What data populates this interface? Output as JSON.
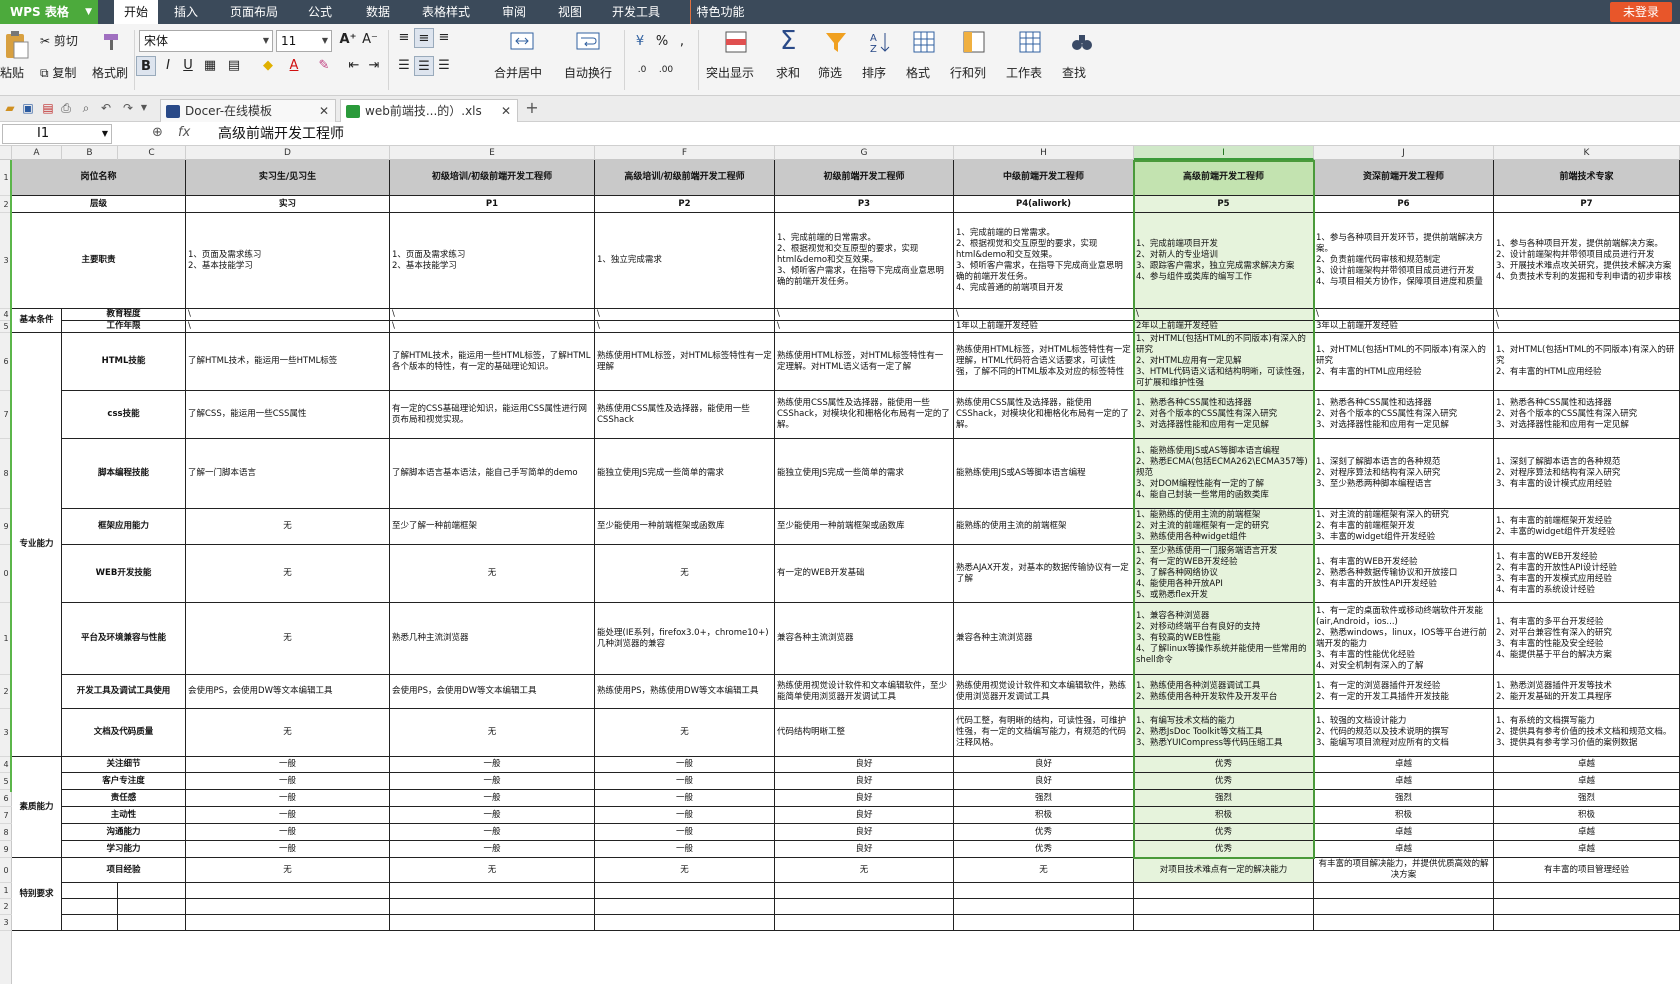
{
  "app": {
    "name": "WPS 表格",
    "login": "未登录"
  },
  "menus": [
    "开始",
    "插入",
    "页面布局",
    "公式",
    "数据",
    "表格样式",
    "审阅",
    "视图",
    "开发工具",
    "特色功能"
  ],
  "ribbon": {
    "paste": "粘贴",
    "cut": "剪切",
    "copy": "复制",
    "format_painter": "格式刷",
    "font_name": "宋体",
    "font_size": "11",
    "merge_center": "合并居中",
    "wrap_text": "自动换行",
    "percent": "%",
    "highlight": "突出显示",
    "sum": "求和",
    "filter": "筛选",
    "sort": "排序",
    "format": "格式",
    "rows_cols": "行和列",
    "worksheet": "工作表",
    "find": "查找"
  },
  "tabs": [
    {
      "label": "Docer-在线模板"
    },
    {
      "label": "web前端技...的）.xls"
    }
  ],
  "formula_bar": {
    "cell_ref": "I1",
    "content": "高级前端开发工程师"
  },
  "column_letters": [
    "A",
    "B",
    "C",
    "D",
    "E",
    "F",
    "G",
    "H",
    "I",
    "J",
    "K"
  ],
  "row_numbers": [
    "1",
    "2",
    "3",
    "4",
    "5",
    "6",
    "7",
    "8",
    "9",
    "0",
    "1",
    "2",
    "3",
    "4",
    "5",
    "6",
    "7",
    "8",
    "9",
    "0",
    "1",
    "2",
    "3"
  ],
  "sheet": {
    "header": {
      "name": "岗位名称",
      "titles": [
        "实习生/见习生",
        "初级培训/初级前端开发工程师",
        "高级培训/初级前端开发工程师",
        "初级前端开发工程师",
        "中级前端开发工程师",
        "高级前端开发工程师",
        "资深前端开发工程师",
        "前端技术专家"
      ]
    },
    "levels_label": "层级",
    "levels": [
      "实习",
      "P1",
      "P2",
      "P3",
      "P4(aliwork)",
      "P5",
      "P6",
      "P7"
    ],
    "duties_label": "主要职责",
    "duties": [
      "1、页面及需求练习\n2、基本技能学习",
      "1、页面及需求练习\n2、基本技能学习",
      "1、独立完成需求",
      "1、完成前端的日常需求。\n2、根据视觉和交互原型的要求，实现html&demo和交互效果。\n3、倾听客户需求，在指导下完成商业意思明确的前端开发任务。",
      "1、完成前端的日常需求。\n2、根据视觉和交互原型的要求，实现html&demo和交互效果。\n3、倾听客户需求，在指导下完成商业意思明确的前端开发任务。\n4、完成普通的前端项目开发",
      "1、完成前端项目开发\n2、对新人的专业培训\n3、跟踪客户需求，独立完成需求解决方案\n4、参与组件或类库的编写工作",
      "1、参与各种项目开发环节，提供前端解决方案。\n2、负责前端代码审核和规范制定\n3、设计前端架构并带领项目成员进行开发\n4、与项目相关方协作，保障项目进度和质量",
      "1、参与各种项目开发，提供前端解决方案。\n2、设计前端架构并带领项目成员进行开发\n3、开展技术难点攻关研究，提供技术解决方案\n4、负责技术专利的发掘和专利申请的初步审核"
    ],
    "basic_label": "基本条件",
    "edu_label": "教育程度",
    "edu": [
      "\\",
      "\\",
      "\\",
      "\\",
      "\\",
      "\\",
      "\\",
      "\\"
    ],
    "years_label": "工作年限",
    "years": [
      "\\",
      "\\",
      "\\",
      "\\",
      "1年以上前端开发经验",
      "2年以上前端开发经验",
      "3年以上前端开发经验",
      "\\"
    ],
    "pro_label": "专业能力",
    "quality_label": "素质能力",
    "special_label": "特别要求",
    "skills": [
      {
        "name": "HTML技能",
        "vals": [
          "了解HTML技术，能运用一些HTML标签",
          "了解HTML技术，能运用一些HTML标签，了解HTML各个版本的特性，有一定的基础理论知识。",
          "熟练使用HTML标签，对HTML标签特性有一定理解",
          "熟练使用HTML标签，对HTML标签特性有一定理解。对HTML语义话有一定了解",
          "熟练使用HTML标签，对HTML标签特性有一定理解，HTML代码符合语义话要求，可读性强，了解不同的HTML版本及对应的标签特性",
          "1、对HTML(包括HTML的不同版本)有深入的研究\n2、对HTML应用有一定见解\n3、HTML代码语义话和结构明晰，可读性强，可扩展和维护性强",
          "1、对HTML(包括HTML的不同版本)有深入的研究\n2、有丰富的HTML应用经验",
          "1、对HTML(包括HTML的不同版本)有深入的研究\n2、有丰富的HTML应用经验"
        ]
      },
      {
        "name": "css技能",
        "vals": [
          "了解CSS，能运用一些CSS属性",
          "有一定的CSS基础理论知识，能运用CSS属性进行网页布局和视觉实现。",
          "熟练使用CSS属性及选择器，能使用一些CSShack",
          "熟练使用CSS属性及选择器，能使用一些CSShack，对模块化和栅格化布局有一定的了解。",
          "熟练使用CSS属性及选择器，能使用CSShack，对模块化和栅格化布局有一定的了解。",
          "1、熟悉各种CSS属性和选择器\n2、对各个版本的CSS属性有深入研究\n3、对选择器性能和应用有一定见解",
          "1、熟悉各种CSS属性和选择器\n2、对各个版本的CSS属性有深入研究\n3、对选择器性能和应用有一定见解",
          "1、熟悉各种CSS属性和选择器\n2、对各个版本的CSS属性有深入研究\n3、对选择器性能和应用有一定见解"
        ]
      },
      {
        "name": "脚本编程技能",
        "vals": [
          "了解一门脚本语言",
          "了解脚本语言基本语法，能自己手写简单的demo",
          "能独立使用JS完成一些简单的需求",
          "能独立使用JS完成一些简单的需求",
          "能熟练使用JS或AS等脚本语言编程",
          "1、能熟练使用JS或AS等脚本语言编程\n2、熟悉ECMA(包括ECMA262\\ECMA357等)规范\n3、对DOM编程性能有一定的了解\n4、能自己封装一些常用的函数类库",
          "1、深刻了解脚本语言的各种规范\n2、对程序算法和结构有深入研究\n3、至少熟悉两种脚本编程语言",
          "1、深刻了解脚本语言的各种规范\n2、对程序算法和结构有深入研究\n3、有丰富的设计模式应用经验"
        ]
      },
      {
        "name": "框架应用能力",
        "vals": [
          "无",
          "至少了解一种前端框架",
          "至少能使用一种前端框架或函数库",
          "至少能使用一种前端框架或函数库",
          "能熟练的使用主流的前端框架",
          "1、能熟练的使用主流的前端框架\n2、对主流的前端框架有一定的研究\n3、熟练使用各种widget组件",
          "1、对主流的前端框架有深入的研究\n2、有丰富的前端框架开发\n3、丰富的widget组件开发经验",
          "1、有丰富的前端框架开发经验\n2、丰富的widget组件开发经验"
        ]
      },
      {
        "name": "WEB开发技能",
        "vals": [
          "无",
          "无",
          "无",
          "有一定的WEB开发基础",
          "熟悉AJAX开发，对基本的数据传输协议有一定了解",
          "1、至少熟练使用一门服务端语言开发\n2、有一定的WEB开发经验\n3、了解各种网络协议\n4、能使用各种开放API\n5、或熟悉flex开发",
          "1、有丰富的WEB开发经验\n2、熟悉各种数据传输协议和开放接口\n3、有丰富的开放性API开发经验",
          "1、有丰富的WEB开发经验\n2、有丰富的开放性API设计经验\n3、有丰富的开发模式应用经验\n4、有丰富的系统设计经验"
        ]
      },
      {
        "name": "平台及环境兼容与性能",
        "vals": [
          "无",
          "熟悉几种主流浏览器",
          "能处理(IE系列，firefox3.0+，chrome10+)几种浏览器的兼容",
          "兼容各种主流浏览器",
          "兼容各种主流浏览器",
          "1、兼容各种浏览器\n2、对移动终端平台有良好的支持\n3、有较高的WEB性能\n4、了解linux等操作系统并能使用一些常用的shell命令",
          "1、有一定的桌面软件或移动终端软件开发能(air,Android，ios...)\n2、熟悉windows，linux，IOS等平台进行前端开发的能力\n3、有丰富的性能优化经验\n4、对安全机制有深入的了解",
          "1、有丰富的多平台开发经验\n2、对平台兼容性有深入的研究\n3、有丰富的性能及安全经验\n4、能提供基于平台的解决方案"
        ]
      },
      {
        "name": "开发工具及调试工具使用",
        "vals": [
          "会使用PS，会使用DW等文本编辑工具",
          "会使用PS，会使用DW等文本编辑工具",
          "熟练使用PS，熟练使用DW等文本编辑工具",
          "熟练使用视觉设计软件和文本编辑软件，至少能简单使用浏览器开发调试工具",
          "熟练使用视觉设计软件和文本编辑软件，熟练使用浏览器开发调试工具",
          "1、熟练使用各种浏览器调试工具\n2、熟练使用各种开发软件及开发平台",
          "1、有一定的浏览器插件开发经验\n2、有一定的开发工具插件开发技能",
          "1、熟悉浏览器插件开发等技术\n2、能开发基础的开发工具程序"
        ]
      },
      {
        "name": "文档及代码质量",
        "vals": [
          "无",
          "无",
          "无",
          "代码结构明晰工整",
          "代码工整，有明晰的结构，可读性强，可维护性强，有一定的文档编写能力，有规范的代码注释风格。",
          "1、有编写技术文档的能力\n2、熟悉JsDoc Toolkit等文档工具\n3、熟悉YUICompress等代码压缩工具",
          "1、较强的文档设计能力\n2、代码的规范以及技术说明的撰写\n3、能编写项目流程对应所有的文档",
          "1、有系统的文档撰写能力\n2、提供具有参考价值的技术文档和规范文档。\n3、提供具有参考学习价值的案例数据"
        ]
      }
    ],
    "qualities": [
      {
        "name": "关注细节",
        "vals": [
          "一般",
          "一般",
          "一般",
          "良好",
          "良好",
          "优秀",
          "卓越",
          "卓越"
        ]
      },
      {
        "name": "客户专注度",
        "vals": [
          "一般",
          "一般",
          "一般",
          "良好",
          "良好",
          "优秀",
          "卓越",
          "卓越"
        ]
      },
      {
        "name": "责任感",
        "vals": [
          "一般",
          "一般",
          "一般",
          "良好",
          "强烈",
          "强烈",
          "强烈",
          "强烈"
        ]
      },
      {
        "name": "主动性",
        "vals": [
          "一般",
          "一般",
          "一般",
          "良好",
          "积极",
          "积极",
          "积极",
          "积极"
        ]
      },
      {
        "name": "沟通能力",
        "vals": [
          "一般",
          "一般",
          "一般",
          "良好",
          "优秀",
          "优秀",
          "卓越",
          "卓越"
        ]
      },
      {
        "name": "学习能力",
        "vals": [
          "一般",
          "一般",
          "一般",
          "良好",
          "优秀",
          "优秀",
          "卓越",
          "卓越"
        ]
      }
    ],
    "project_label": "项目经验",
    "projects": [
      "无",
      "无",
      "无",
      "无",
      "无",
      "对项目技术难点有一定的解决能力",
      "有丰富的项目解决能力，并提供优质高效的解决方案",
      "有丰富的项目管理经验"
    ]
  }
}
